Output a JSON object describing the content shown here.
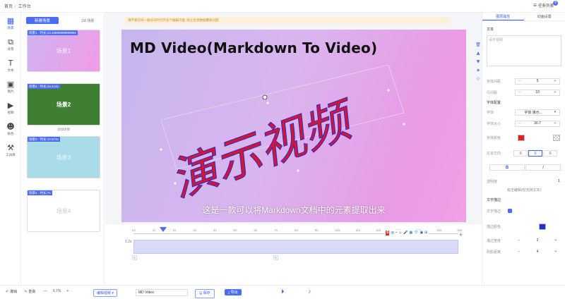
{
  "breadcrumb": [
    "首页",
    "工作台"
  ],
  "topbar": {
    "task_list": "任务列表",
    "badge": "9"
  },
  "rail": [
    {
      "icon": "▦",
      "label": "场景",
      "active": true
    },
    {
      "icon": "⧉",
      "label": "背景"
    },
    {
      "icon": "T",
      "label": "文本"
    },
    {
      "icon": "▣",
      "label": "图片"
    },
    {
      "icon": "▶",
      "label": "视频"
    },
    {
      "icon": "☻",
      "label": "角色"
    },
    {
      "icon": "⚒",
      "label": "工具库"
    }
  ],
  "scenes": {
    "new_button": "新建场景",
    "count": "1/8 场景",
    "items": [
      {
        "tag": "场景1 · 时长:13.4559999999999s",
        "name": "场景1"
      },
      {
        "tag": "场景2 · 时长:10.414s",
        "name": "场景2"
      },
      {
        "tag": "场景3 · 时长:10.872s",
        "name": "场景3"
      },
      {
        "tag": "场景4 · 时长:7s",
        "name": "场景4"
      }
    ],
    "below_labels": [
      "",
      "添加场景",
      ""
    ]
  },
  "canvas": {
    "warning": "请不要在同一账号同时打开多个编辑页面, 防止出现数据覆盖问题",
    "title": "MD Video(Markdown To Video)",
    "calligraphy": "演示视频",
    "subtitle": "这是一款可以将Markdown文档中的元素提取出来"
  },
  "timeline": {
    "ticks": [
      "0s",
      "1s",
      "2s",
      "3s",
      "4s",
      "5s",
      "6s",
      "7s",
      "8s",
      "9s",
      "10s",
      "11s",
      "12s",
      "13s",
      "14s",
      "15s",
      "16s"
    ],
    "track_label": "1.2s",
    "marks": [
      "0",
      "0"
    ],
    "ime": [
      "中",
      "•",
      "☺",
      "🎤",
      "▦",
      "👕",
      "▣",
      "⊞"
    ]
  },
  "bottom": {
    "undo": "撤销",
    "redo": "重做",
    "zoom": "6.7%",
    "mode": "编辑视频",
    "project_name": "MD Video",
    "save": "保存",
    "export": "导出"
  },
  "right_panel": {
    "tabs": [
      "图层属性",
      "动画设置"
    ],
    "text_section": "文本",
    "text_placeholder": "请字视频",
    "font_size_label": "字体间距",
    "font_size_value": "5",
    "line_height_label": "行间距",
    "line_height_value": "10",
    "font_section": "字体配置",
    "font_label": "字体",
    "font_value": "字体:演示...",
    "size_label": "字体大小",
    "size_value": "30.7",
    "color_label": "字体颜色",
    "align_label": "文本方向",
    "style_label": "",
    "opacity_label": "透明度",
    "opacity_value": "1",
    "hint": "双击编辑(仅支持文本)",
    "subtitle_section": "文字描边",
    "stroke_label": "文字描边",
    "stroke_color_label": "描边颜色",
    "stroke_width_label": "描边宽度",
    "stroke_width_value": "2",
    "shadow_label": "阴影距离",
    "shadow_value": "4"
  }
}
